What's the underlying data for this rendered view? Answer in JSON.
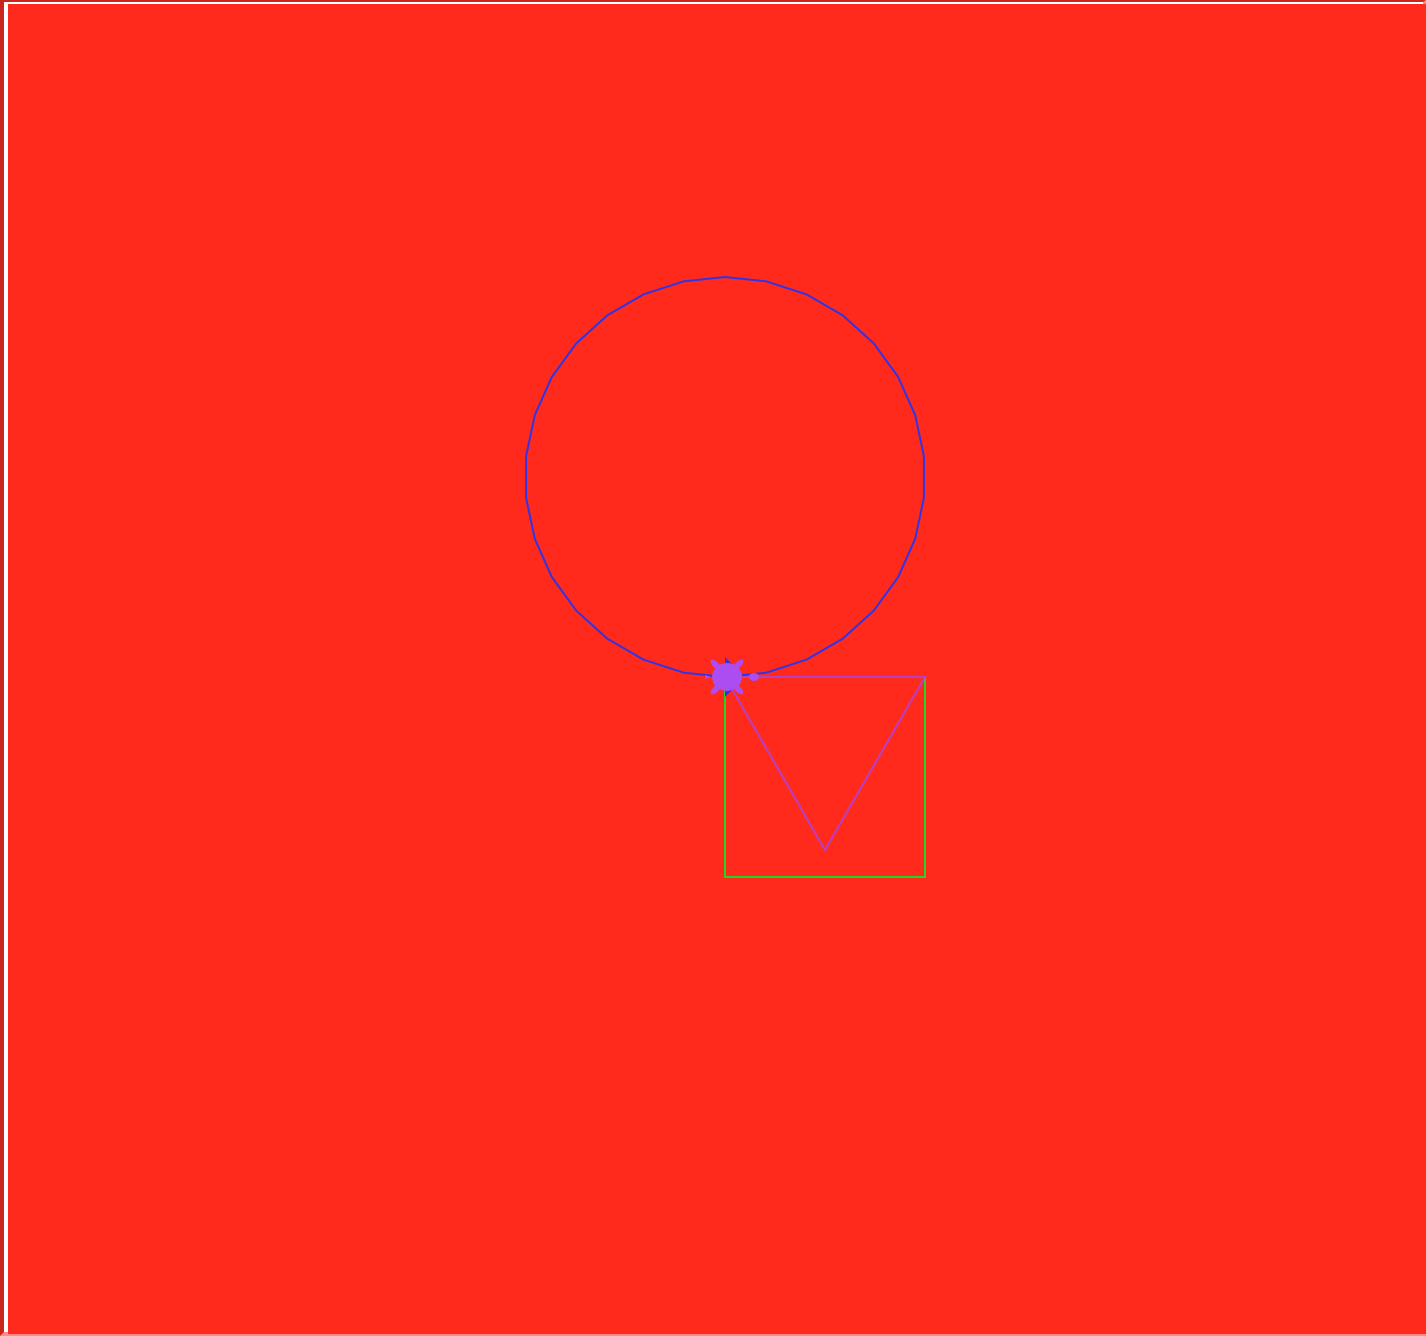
{
  "canvas": {
    "background_color": "#ff2a1c"
  },
  "drawing": {
    "circle": {
      "color": "#2f35e6",
      "segments": 30
    },
    "square": {
      "color": "#25d41f"
    },
    "triangle": {
      "color": "#b73fc6"
    }
  },
  "turtle": {
    "shape": "turtle-icon",
    "color": "#ab4df0",
    "heading": "east"
  }
}
